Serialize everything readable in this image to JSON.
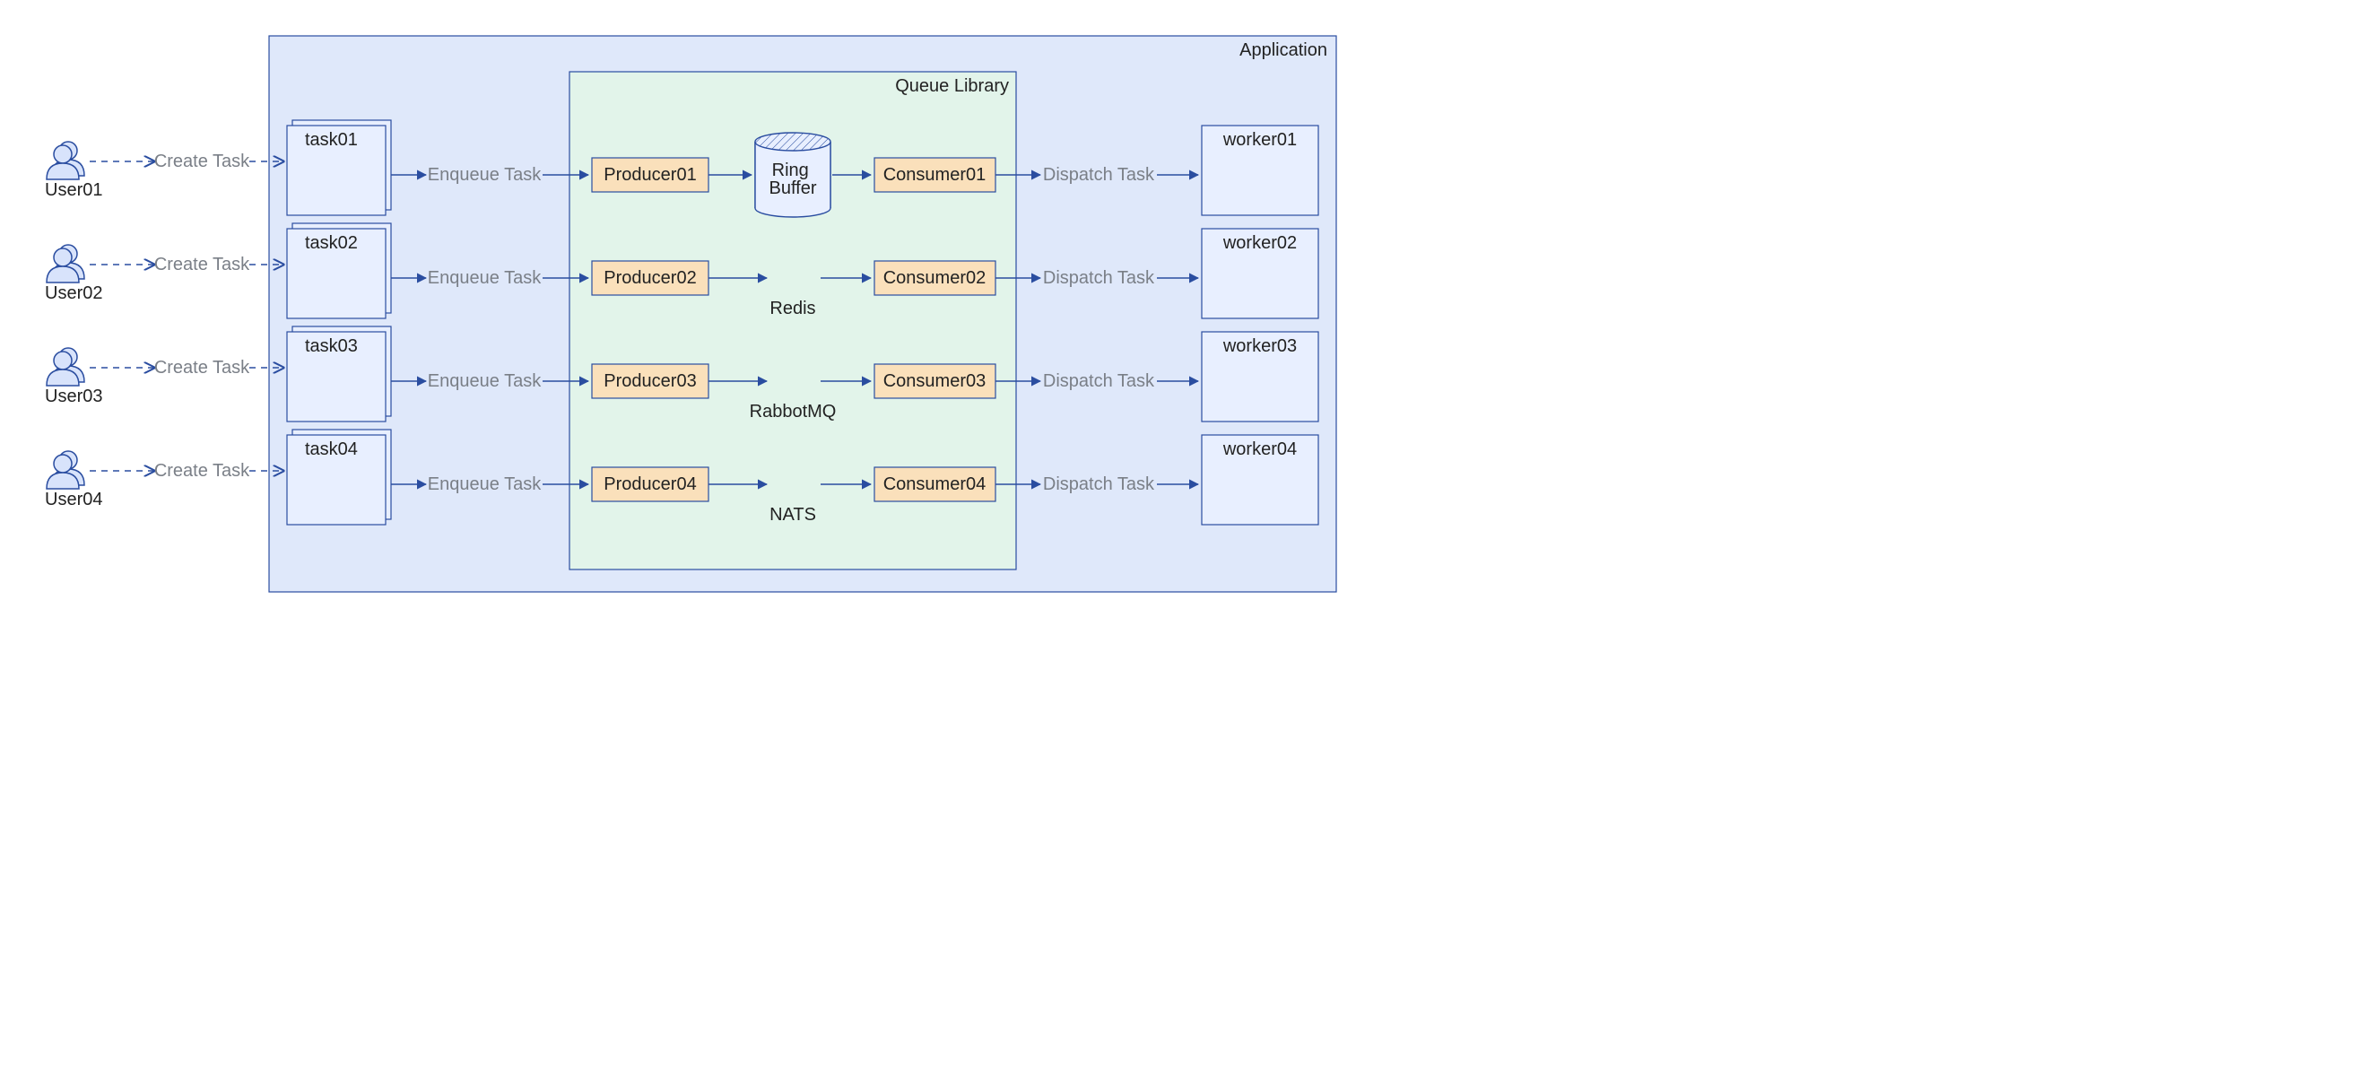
{
  "containers": {
    "application_title": "Application",
    "queue_library_title": "Queue Library"
  },
  "users": [
    {
      "name": "User01"
    },
    {
      "name": "User02"
    },
    {
      "name": "User03"
    },
    {
      "name": "User04"
    }
  ],
  "tasks": [
    {
      "name": "task01"
    },
    {
      "name": "task02"
    },
    {
      "name": "task03"
    },
    {
      "name": "task04"
    }
  ],
  "producers": [
    {
      "name": "Producer01"
    },
    {
      "name": "Producer02"
    },
    {
      "name": "Producer03"
    },
    {
      "name": "Producer04"
    }
  ],
  "consumers": [
    {
      "name": "Consumer01"
    },
    {
      "name": "Consumer02"
    },
    {
      "name": "Consumer03"
    },
    {
      "name": "Consumer04"
    }
  ],
  "queues": [
    {
      "name": "Ring Buffer",
      "shape": "cylinder"
    },
    {
      "name": "Redis",
      "shape": "text"
    },
    {
      "name": "RabbotMQ",
      "shape": "text"
    },
    {
      "name": "NATS",
      "shape": "text"
    }
  ],
  "workers": [
    {
      "name": "worker01"
    },
    {
      "name": "worker02"
    },
    {
      "name": "worker03"
    },
    {
      "name": "worker04"
    }
  ],
  "edge_labels": {
    "create_task": "Create Task",
    "enqueue_task": "Enqueue Task",
    "dispatch_task": "Dispatch Task"
  }
}
